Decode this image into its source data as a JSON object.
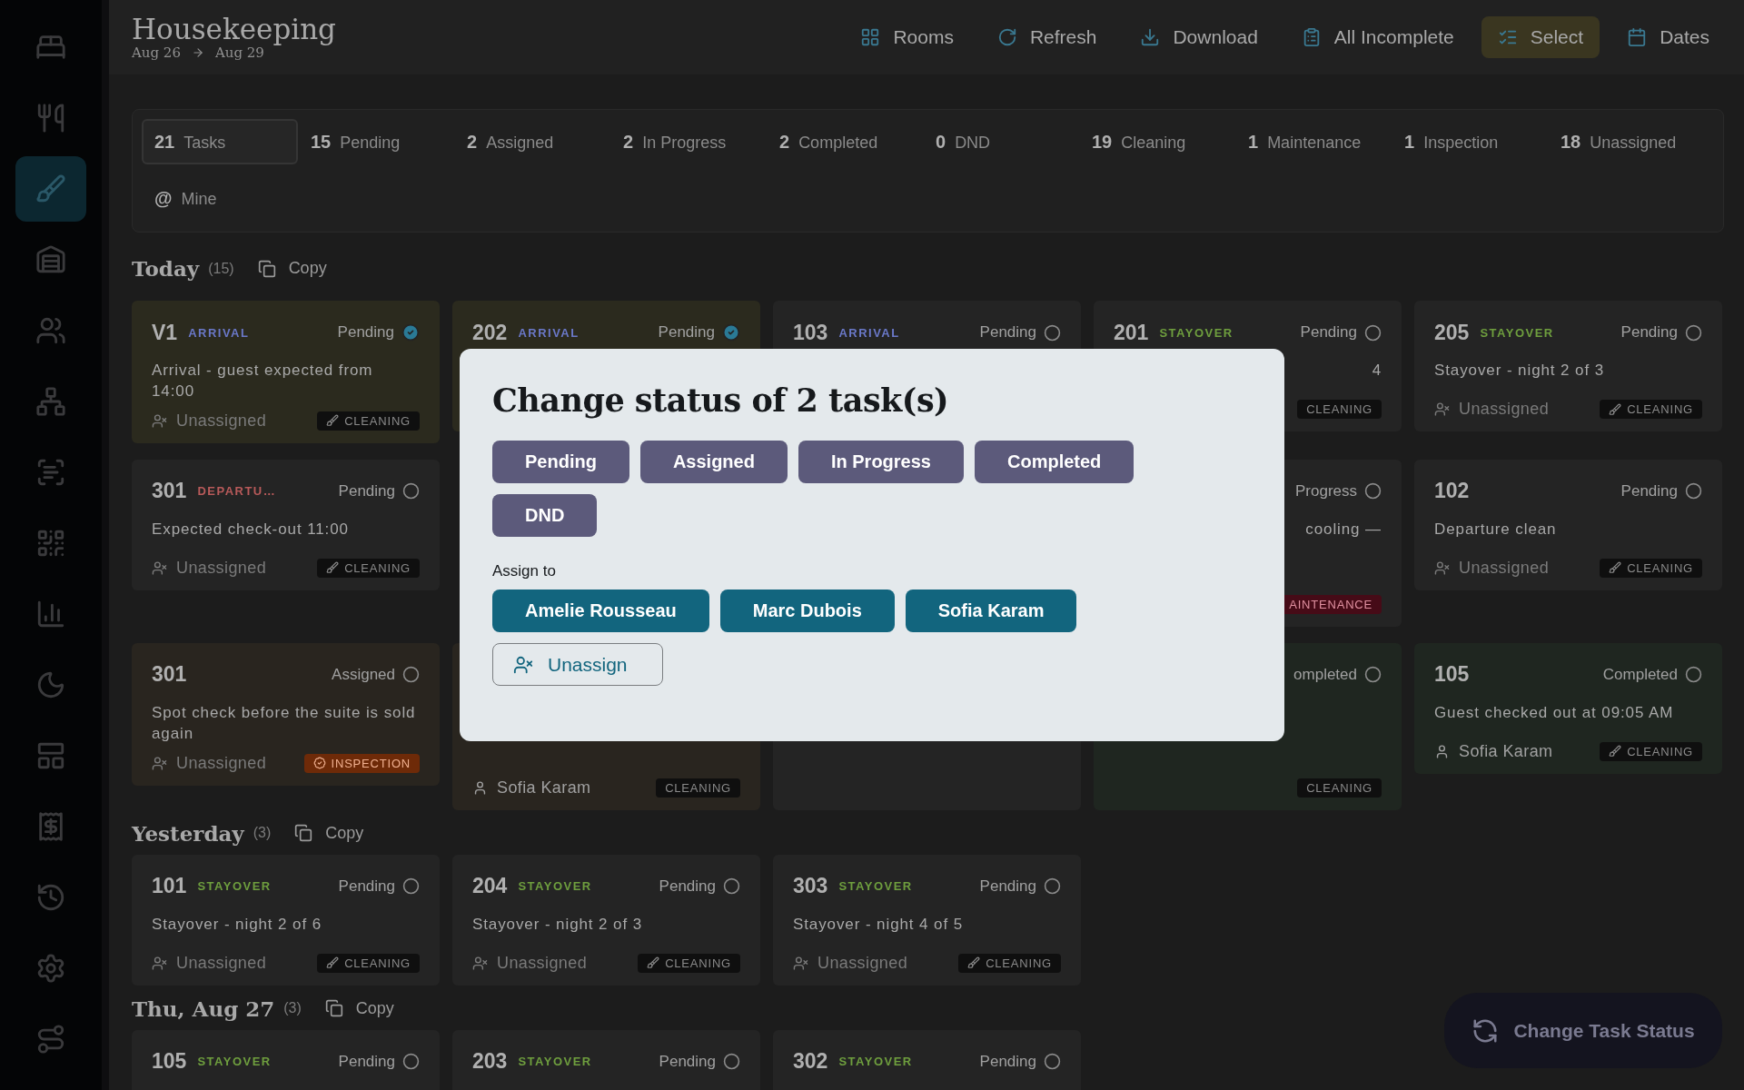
{
  "sidebar": {
    "items": [
      {
        "selected": false
      },
      {
        "selected": false
      },
      {
        "selected": true
      },
      {
        "selected": false
      },
      {
        "selected": false
      },
      {
        "selected": false
      },
      {
        "selected": false
      },
      {
        "selected": false
      },
      {
        "selected": false
      },
      {
        "selected": false
      },
      {
        "selected": false
      },
      {
        "selected": false
      },
      {
        "selected": false
      },
      {
        "selected": false
      },
      {
        "selected": false
      }
    ]
  },
  "header": {
    "title": "Housekeeping",
    "date_from": "Aug 26",
    "date_to": "Aug 29",
    "actions": [
      {
        "label": "Rooms",
        "selected": false
      },
      {
        "label": "Refresh",
        "selected": false
      },
      {
        "label": "Download",
        "selected": false
      },
      {
        "label": "All Incomplete",
        "selected": false
      },
      {
        "label": "Select",
        "selected": true
      },
      {
        "label": "Dates",
        "selected": false
      }
    ]
  },
  "stats": {
    "items": [
      {
        "count": "21",
        "label": "Tasks",
        "selected": true
      },
      {
        "count": "15",
        "label": "Pending",
        "selected": false
      },
      {
        "count": "2",
        "label": "Assigned",
        "selected": false
      },
      {
        "count": "2",
        "label": "In Progress",
        "selected": false
      },
      {
        "count": "2",
        "label": "Completed",
        "selected": false
      },
      {
        "count": "0",
        "label": "DND",
        "selected": false
      },
      {
        "count": "19",
        "label": "Cleaning",
        "selected": false
      },
      {
        "count": "1",
        "label": "Maintenance",
        "selected": false
      },
      {
        "count": "1",
        "label": "Inspection",
        "selected": false
      },
      {
        "count": "18",
        "label": "Unassigned",
        "selected": false
      }
    ],
    "mine": {
      "symbol": "@",
      "label": "Mine"
    }
  },
  "sections": [
    {
      "title": "Today",
      "count": "(15)",
      "copy": "Copy",
      "cards": [
        {
          "kind": "full",
          "color": "#2b2a1e",
          "room": "V1",
          "type": {
            "label": "ARRIVAL",
            "kind": "arrival"
          },
          "status": "Pending",
          "selected": true,
          "description": "Arrival - guest expected from 14:00",
          "assignee": {
            "name": "Unassigned",
            "assigned": false
          },
          "tag": {
            "label": "CLEANING",
            "kind": "cleaning"
          }
        },
        {
          "kind": "full",
          "color": "#2b2a1e",
          "room": "202",
          "type": {
            "label": "ARRIVAL",
            "kind": "arrival"
          },
          "status": "Pending",
          "selected": true
        },
        {
          "kind": "full",
          "color": "#242424",
          "room": "103",
          "type": {
            "label": "ARRIVAL",
            "kind": "arrival"
          },
          "status": "Pending",
          "selected": false
        },
        {
          "kind": "covered",
          "color": "#242424",
          "room": "201",
          "type": {
            "label": "STAYOVER",
            "kind": "stayover"
          },
          "status": "Pending",
          "selected": false,
          "description": "4",
          "tag": {
            "label": "CLEANING",
            "kind": "cleaning"
          }
        },
        {
          "kind": "full",
          "color": "#242424",
          "room": "205",
          "type": {
            "label": "STAYOVER",
            "kind": "stayover"
          },
          "status": "Pending",
          "selected": false,
          "description": "Stayover - night 2 of 3",
          "assignee": {
            "name": "Unassigned",
            "assigned": false
          },
          "tag": {
            "label": "CLEANING",
            "kind": "cleaning"
          }
        },
        {
          "kind": "full",
          "color": "#242424",
          "room": "301",
          "type": {
            "label": "DEPARTU…",
            "kind": "departure"
          },
          "status": "Pending",
          "selected": false,
          "description": "Expected check-out 11:00",
          "assignee": {
            "name": "Unassigned",
            "assigned": false
          },
          "tag": {
            "label": "CLEANING",
            "kind": "cleaning"
          }
        },
        {
          "kind": "hidden"
        },
        {
          "kind": "hidden"
        },
        {
          "kind": "covered",
          "color": "#242424",
          "status": "Progress",
          "selected": false,
          "description": "cooling —",
          "tag": {
            "label": "AINTENANCE",
            "kind": "maintenance"
          }
        },
        {
          "kind": "full",
          "color": "#242424",
          "room": "102",
          "status": "Pending",
          "selected": false,
          "description": "Departure clean",
          "assignee": {
            "name": "Unassigned",
            "assigned": false
          },
          "tag": {
            "label": "CLEANING",
            "kind": "cleaning"
          }
        },
        {
          "kind": "full",
          "color": "#29251f",
          "room": "301",
          "status": "Assigned",
          "selected": false,
          "description": "Spot check before the suite is sold again",
          "assignee": {
            "name": "Unassigned",
            "assigned": false
          },
          "tag": {
            "label": "INSPECTION",
            "kind": "inspection"
          }
        },
        {
          "kind": "covered",
          "color": "#29251f",
          "assignee": {
            "name": "Sofia Karam",
            "assigned": true
          },
          "tag": {
            "label": "CLEANING",
            "kind": "cleaning"
          }
        },
        {
          "kind": "covered",
          "color": "#242424"
        },
        {
          "kind": "covered",
          "color": "#1f2620",
          "status": "ompleted",
          "selected": false,
          "tag": {
            "label": "CLEANING",
            "kind": "cleaning"
          }
        },
        {
          "kind": "full",
          "color": "#1f2620",
          "room": "105",
          "status": "Completed",
          "selected": false,
          "description": "Guest checked out at 09:05 AM",
          "assignee": {
            "name": "Sofia Karam",
            "assigned": true
          },
          "tag": {
            "label": "CLEANING",
            "kind": "cleaning"
          }
        }
      ]
    },
    {
      "title": "Yesterday",
      "count": "(3)",
      "copy": "Copy",
      "cards": [
        {
          "kind": "full",
          "color": "#242424",
          "room": "101",
          "type": {
            "label": "STAYOVER",
            "kind": "stayover"
          },
          "status": "Pending",
          "selected": false,
          "description": "Stayover - night 2 of 6",
          "assignee": {
            "name": "Unassigned",
            "assigned": false
          },
          "tag": {
            "label": "CLEANING",
            "kind": "cleaning"
          }
        },
        {
          "kind": "full",
          "color": "#242424",
          "room": "204",
          "type": {
            "label": "STAYOVER",
            "kind": "stayover"
          },
          "status": "Pending",
          "selected": false,
          "description": "Stayover - night 2 of 3",
          "assignee": {
            "name": "Unassigned",
            "assigned": false
          },
          "tag": {
            "label": "CLEANING",
            "kind": "cleaning"
          }
        },
        {
          "kind": "full",
          "color": "#242424",
          "room": "303",
          "type": {
            "label": "STAYOVER",
            "kind": "stayover"
          },
          "status": "Pending",
          "selected": false,
          "description": "Stayover - night 4 of 5",
          "assignee": {
            "name": "Unassigned",
            "assigned": false
          },
          "tag": {
            "label": "CLEANING",
            "kind": "cleaning"
          }
        }
      ]
    },
    {
      "title": "Thu, Aug 27",
      "count": "(3)",
      "copy": "Copy",
      "cards": [
        {
          "kind": "full",
          "color": "#242424",
          "room": "105",
          "type": {
            "label": "STAYOVER",
            "kind": "stayover"
          },
          "status": "Pending",
          "selected": false
        },
        {
          "kind": "full",
          "color": "#242424",
          "room": "203",
          "type": {
            "label": "STAYOVER",
            "kind": "stayover"
          },
          "status": "Pending",
          "selected": false
        },
        {
          "kind": "full",
          "color": "#242424",
          "room": "302",
          "type": {
            "label": "STAYOVER",
            "kind": "stayover"
          },
          "status": "Pending",
          "selected": false
        }
      ]
    }
  ],
  "fab": {
    "label": "Change Task Status"
  },
  "dialog": {
    "title": "Change status of 2 task(s)",
    "statuses": [
      "Pending",
      "Assigned",
      "In Progress",
      "Completed",
      "DND"
    ],
    "assign_label": "Assign to",
    "staff": [
      "Amelie Rousseau",
      "Marc Dubois",
      "Sofia Karam"
    ],
    "unassign": "Unassign"
  }
}
